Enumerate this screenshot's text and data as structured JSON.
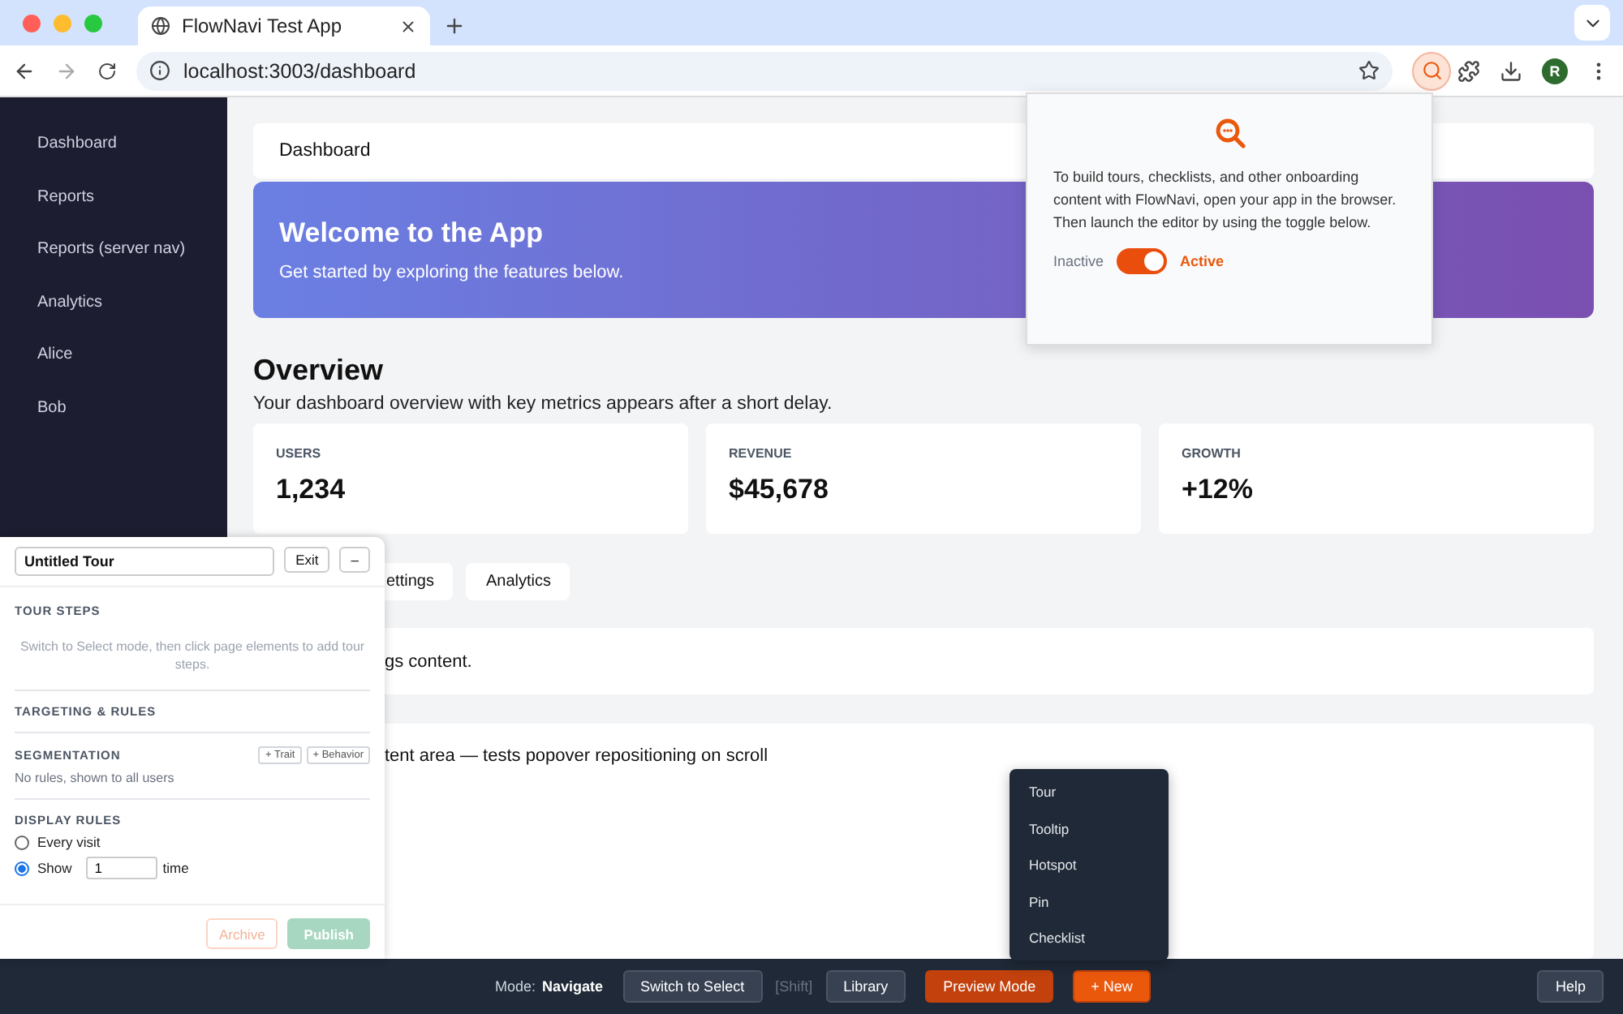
{
  "browser": {
    "tab_title": "FlowNavi Test App",
    "url": "localhost:3003/dashboard",
    "profile_initial": "R"
  },
  "sidebar": {
    "items": [
      {
        "label": "Dashboard",
        "selected": false
      },
      {
        "label": "Reports",
        "selected": false
      },
      {
        "label": "Reports (server nav)",
        "selected": false
      },
      {
        "label": "Analytics",
        "selected": false
      },
      {
        "label": "Alice",
        "selected": false
      },
      {
        "label": "Bob",
        "selected": false
      }
    ]
  },
  "header": {
    "title": "Dashboard"
  },
  "banner": {
    "title": "Welcome to the App",
    "subtitle": "Get started by exploring the features below."
  },
  "overview": {
    "title": "Overview",
    "subtitle": "Your dashboard overview with key metrics appears after a short delay."
  },
  "stats": [
    {
      "label": "USERS",
      "value": "1,234"
    },
    {
      "label": "REVENUE",
      "value": "$45,678"
    },
    {
      "label": "GROWTH",
      "value": "+12%"
    }
  ],
  "tabs": [
    {
      "label": "ettings",
      "selected": false
    },
    {
      "label": "Analytics",
      "selected": false
    }
  ],
  "panel_text": "gs content.",
  "scroll_area_text": "tent area — tests popover repositioning on scroll",
  "extension_popup": {
    "text": "To build tours, checklists, and other onboarding content with FlowNavi, open your app in the browser. Then launch the editor by using the toggle below.",
    "off_label": "Inactive",
    "on_label": "Active",
    "on": true
  },
  "editor": {
    "tour_name": "Untitled Tour",
    "exit": "Exit",
    "minimize": "–",
    "steps_heading": "TOUR STEPS",
    "steps_hint": "Switch to Select mode, then click page elements to add tour steps.",
    "targeting_heading": "TARGETING & RULES",
    "segmentation_heading": "SEGMENTATION",
    "trait_button": "+ Trait",
    "behavior_button": "+ Behavior",
    "segmentation_note": "No rules, shown to all users",
    "display_heading": "DISPLAY RULES",
    "display_options": [
      {
        "label": "Every visit",
        "selected": false
      },
      {
        "label": "Show",
        "selected": true
      }
    ],
    "show_count": "1",
    "show_unit": "time",
    "archive": "Archive",
    "publish": "Publish"
  },
  "new_menu": {
    "items": [
      "Tour",
      "Tooltip",
      "Hotspot",
      "Pin",
      "Checklist"
    ]
  },
  "bottom_bar": {
    "mode_label": "Mode:",
    "mode_value": "Navigate",
    "switch_button": "Switch to Select",
    "shortcut": "[Shift]",
    "library": "Library",
    "preview": "Preview Mode",
    "new": "+ New",
    "help": "Help"
  }
}
